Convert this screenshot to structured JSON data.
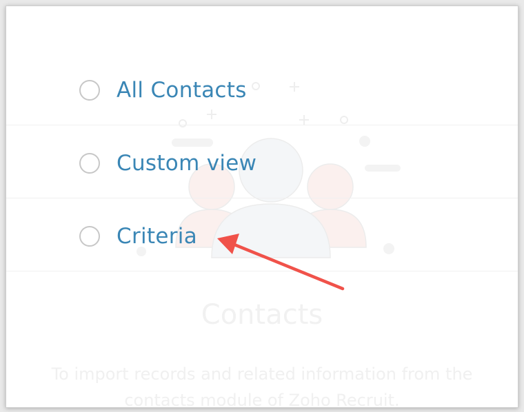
{
  "options": [
    {
      "label": "All Contacts",
      "selected": false
    },
    {
      "label": "Custom view",
      "selected": false
    },
    {
      "label": "Criteria",
      "selected": false
    }
  ],
  "background": {
    "title": "Contacts",
    "description": "To import records and related information from the contacts module of Zoho Recruit."
  },
  "colors": {
    "accent": "#3a86b5",
    "annotation_arrow": "#f0524a"
  },
  "icons": {
    "illustration": "contacts-group-icon",
    "annotation": "arrow-annotation-icon"
  }
}
